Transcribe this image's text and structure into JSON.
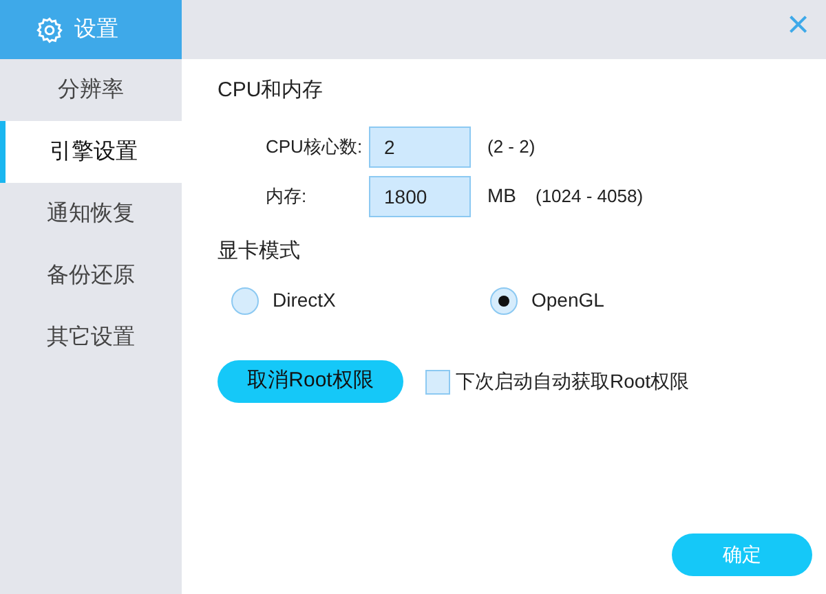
{
  "sidebar": {
    "title": "设置",
    "items": [
      {
        "label": "分辨率",
        "selected": false
      },
      {
        "label": "引擎设置",
        "selected": true
      },
      {
        "label": "通知恢复",
        "selected": false
      },
      {
        "label": "备份还原",
        "selected": false
      },
      {
        "label": "其它设置",
        "selected": false
      }
    ]
  },
  "close_button": "×",
  "cpu_memory": {
    "title": "CPU和内存",
    "fields": [
      {
        "label": "CPU核心数:",
        "value": "2",
        "range": "(2 - 2)"
      },
      {
        "label": "内存:",
        "value": "1800",
        "unit": "MB",
        "range": "(1024 - 4058)"
      }
    ]
  },
  "graphics": {
    "title": "显卡模式",
    "options": [
      {
        "label": "DirectX",
        "selected": false
      },
      {
        "label": "OpenGL",
        "selected": true
      }
    ]
  },
  "root_button": "取消Root权限",
  "root_checkbox": {
    "label": "下次启动自动获取Root权限",
    "checked": false
  },
  "ok_button": "确定"
}
